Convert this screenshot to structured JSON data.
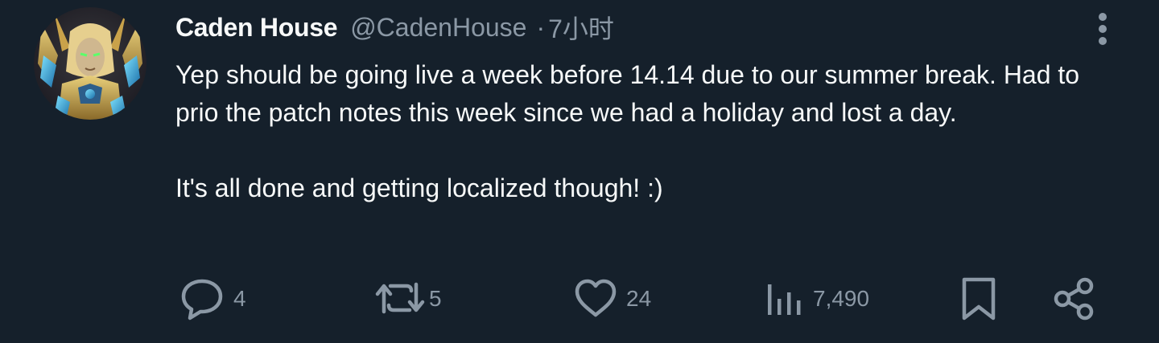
{
  "author": {
    "display_name": "Caden House",
    "handle": "@CadenHouse",
    "separator": "·",
    "time": "7小时",
    "avatar_icon": "avatar-armored-paladin"
  },
  "tweet": {
    "paragraphs": [
      "Yep should be going live a week before 14.14 due to our summer break. Had to prio the patch notes this week since we had a holiday and lost a day.",
      "It's all done and getting localized though! :)"
    ]
  },
  "actions": {
    "reply": {
      "icon": "reply-icon",
      "count": "4"
    },
    "retweet": {
      "icon": "retweet-icon",
      "count": "5"
    },
    "like": {
      "icon": "heart-icon",
      "count": "24"
    },
    "views": {
      "icon": "views-chart-icon",
      "count": "7,490"
    },
    "bookmark": {
      "icon": "bookmark-icon"
    },
    "share": {
      "icon": "share-icon"
    },
    "more": {
      "icon": "more-vertical-icon"
    }
  },
  "colors": {
    "background": "#15202b",
    "text_primary": "#f7f9f9",
    "text_secondary": "#8b98a5"
  }
}
